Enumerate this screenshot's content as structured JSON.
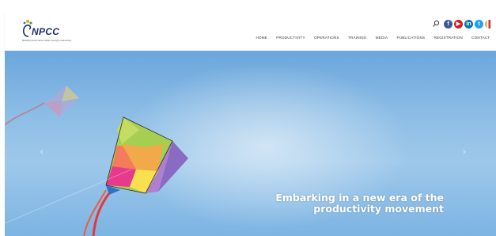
{
  "brand": {
    "name": "NPCC",
    "tagline": "Building world class Indian through productivity"
  },
  "header": {
    "social": [
      {
        "name": "facebook",
        "glyph": "f",
        "color": "#3b5998"
      },
      {
        "name": "youtube",
        "glyph": "▶",
        "color": "#cc1f1f"
      },
      {
        "name": "linkedin",
        "glyph": "in",
        "color": "#0e76a8"
      },
      {
        "name": "twitter",
        "glyph": "t",
        "color": "#1da1f2"
      }
    ],
    "nav": [
      "HOME",
      "PRODUCTIVITY",
      "OPERATIONS",
      "TRAINING",
      "MEDIA",
      "PUBLICATIONS",
      "REGISTRATION",
      "CONTACT"
    ]
  },
  "hero": {
    "caption_line1": "Embarking in a new era of the",
    "caption_line2": "productivity movement",
    "prev_glyph": "‹",
    "next_glyph": "›"
  },
  "colors": {
    "brand_navy": "#1b2f6e",
    "sky": "#8dbde6"
  }
}
